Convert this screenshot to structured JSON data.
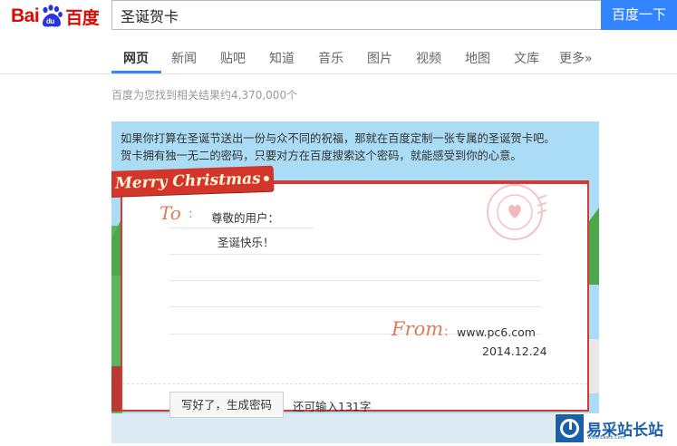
{
  "header": {
    "logo_latin": "Bai",
    "logo_paw": "du",
    "logo_chinese": "百度",
    "search_value": "圣诞贺卡",
    "search_button": "百度一下"
  },
  "nav": {
    "tabs": [
      {
        "label": "网页",
        "active": true
      },
      {
        "label": "新闻",
        "active": false
      },
      {
        "label": "贴吧",
        "active": false
      },
      {
        "label": "知道",
        "active": false
      },
      {
        "label": "音乐",
        "active": false
      },
      {
        "label": "图片",
        "active": false
      },
      {
        "label": "视频",
        "active": false
      },
      {
        "label": "地图",
        "active": false
      },
      {
        "label": "文库",
        "active": false
      },
      {
        "label": "更多»",
        "active": false
      }
    ]
  },
  "results": {
    "count_text": "百度为您找到相关结果约4,370,000个"
  },
  "card": {
    "intro_line1": "如果你打算在圣诞节送出一份与众不同的祝福，那就在百度定制一张专属的圣诞贺卡吧。",
    "intro_line2": "贺卡拥有独一无二的密码，只要对方在百度搜索这个密码，就能感受到你的心意。",
    "ribbon_text": "Merry Christmas",
    "to_label": "To",
    "to_colon": ":",
    "to_name": "尊敬的用户：",
    "message": "圣诞快乐！",
    "from_label": "From",
    "from_colon": ":",
    "from_site": "www.pc6.com",
    "from_date": "2014.12.24",
    "generate_button": "写好了，生成密码",
    "remaining_text": "还可输入131字"
  },
  "watermark": {
    "text": "易采站长站",
    "sub": "Www.Easck.Com"
  },
  "colors": {
    "baidu_red": "#e10602",
    "baidu_blue": "#3385ff",
    "card_bg": "#aadcf5",
    "card_border": "#d23a34"
  },
  "icons": {
    "logo": "baidu-paw-icon",
    "stamp": "postmark-heart-icon",
    "watermark": "easck-logo-icon"
  }
}
